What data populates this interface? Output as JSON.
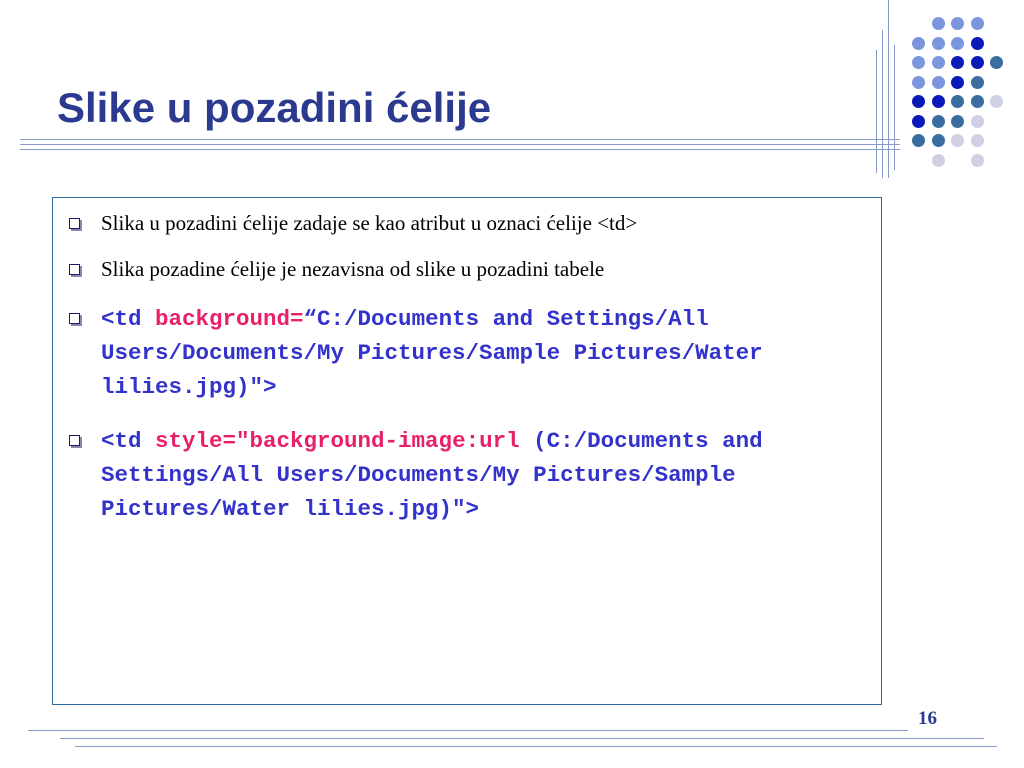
{
  "slide": {
    "title": "Slike u pozadini ćelije",
    "page_number": "16"
  },
  "bullets": [
    {
      "text": "Slika u pozadini ćelije zadaje se kao atribut u oznaci ćelije <td>"
    },
    {
      "text": "Slika pozadine ćelije je nezavisna od slike u pozadini tabele"
    },
    {
      "code_part1": "<td ",
      "code_highlight": "background=",
      "code_part2": "“C:/Documents and Settings/All Users/Documents/My Pictures/Sample Pictures/Water lilies.jpg)\">"
    },
    {
      "code_part1": "<td ",
      "code_highlight": "style=\"background-image:url",
      "code_part2": " (C:/Documents and Settings/All Users/Documents/My Pictures/Sample Pictures/Water lilies.jpg)\">"
    }
  ],
  "colors": {
    "title": "#2b3a8e",
    "code": "#3333cc",
    "code_highlight": "#e8206a",
    "frame_border": "#2b6a9e",
    "rules": "#8899cc",
    "dot_light": "#7b96dd",
    "dot_navy": "#0a1ab8",
    "dot_teal": "#3a6e9e",
    "dot_pale": "#d0d0e4"
  },
  "decor": {
    "dot_grid_rows": [
      [
        "",
        "light",
        "light",
        "light",
        ""
      ],
      [
        "light",
        "light",
        "light",
        "navy",
        ""
      ],
      [
        "light",
        "light",
        "navy",
        "navy",
        "teal"
      ],
      [
        "light",
        "light",
        "navy",
        "teal",
        ""
      ],
      [
        "navy",
        "navy",
        "teal",
        "teal",
        "pale"
      ],
      [
        "navy",
        "teal",
        "teal",
        "pale",
        ""
      ],
      [
        "teal",
        "teal",
        "pale",
        "pale",
        ""
      ],
      [
        "",
        "pale",
        "",
        "pale",
        ""
      ]
    ]
  }
}
